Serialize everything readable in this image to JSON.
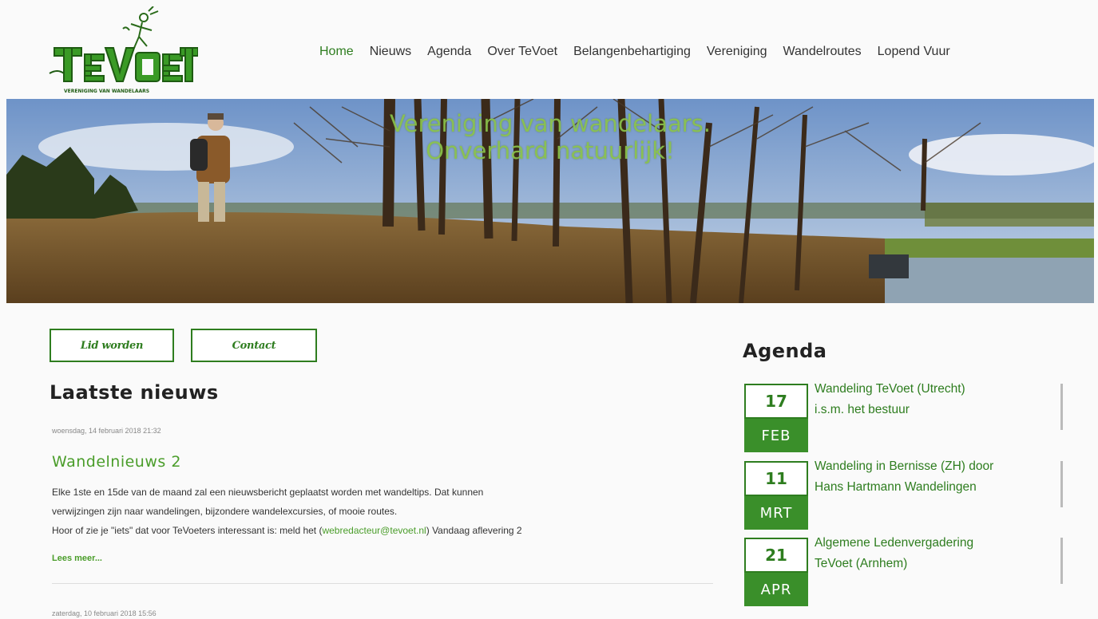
{
  "logo": {
    "text": "TeVoet",
    "subtitle": "VERENIGING VAN WANDELAARS"
  },
  "nav": {
    "items": [
      {
        "label": "Home",
        "active": true
      },
      {
        "label": "Nieuws",
        "active": false
      },
      {
        "label": "Agenda",
        "active": false
      },
      {
        "label": "Over TeVoet",
        "active": false
      },
      {
        "label": "Belangenbehartiging",
        "active": false
      },
      {
        "label": "Vereniging",
        "active": false
      },
      {
        "label": "Wandelroutes",
        "active": false
      },
      {
        "label": "Lopend Vuur",
        "active": false
      }
    ]
  },
  "hero": {
    "tagline_line1": "Vereniging van wandelaars.",
    "tagline_line2": "Onverhard natuurlijk!"
  },
  "buttons": {
    "join": "Lid worden",
    "contact": "Contact"
  },
  "news": {
    "section_title": "Laatste nieuws",
    "items": [
      {
        "date": "woensdag, 14 februari 2018 21:32",
        "title": "Wandelnieuws 2",
        "body_line1": "Elke 1ste en 15de van de maand zal een nieuwsbericht geplaatst worden met wandeltips. Dat kunnen",
        "body_line2": "verwijzingen zijn naar wandelingen, bijzondere wandelexcursies, of mooie routes.",
        "body_line3_pre": "Hoor of zie je \"iets\" dat voor TeVoeters interessant is: meld het (",
        "body_link": "webredacteur@tevoet.nl",
        "body_line3_post": ") Vandaag aflevering 2",
        "read_more": "Lees meer..."
      },
      {
        "date": "zaterdag, 10 februari 2018 15:56"
      }
    ]
  },
  "agenda": {
    "title": "Agenda",
    "items": [
      {
        "day": "17",
        "month": "FEB",
        "line1": "Wandeling TeVoet (Utrecht)",
        "line2": "i.s.m. het bestuur"
      },
      {
        "day": "11",
        "month": "MRT",
        "line1": "Wandeling in Bernisse (ZH) door",
        "line2": "Hans Hartmann Wandelingen"
      },
      {
        "day": "21",
        "month": "APR",
        "line1": "Algemene Ledenvergadering",
        "line2": "TeVoet (Arnhem)"
      }
    ]
  },
  "colors": {
    "brand_green": "#2e7d1f",
    "accent_green": "#4a9d2a",
    "tagline_green": "#8bc34a"
  }
}
